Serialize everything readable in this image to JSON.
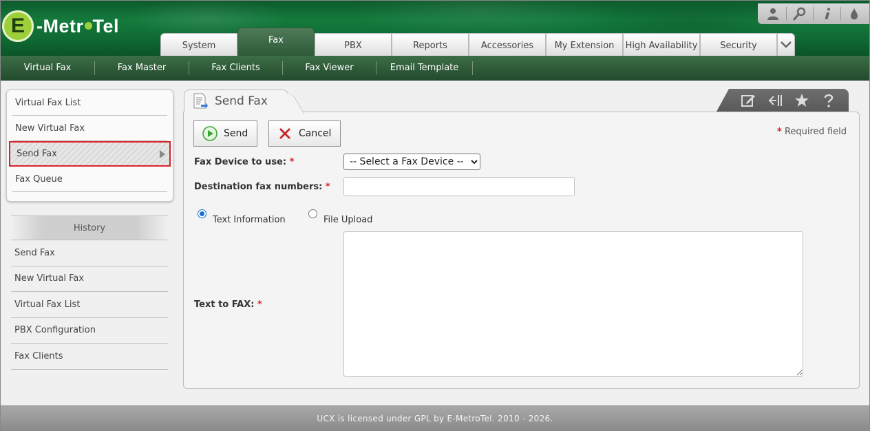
{
  "brand": {
    "logo_letter": "E",
    "logo_word_1": "-Metr",
    "logo_word_2": "Tel"
  },
  "top_tools": [
    "user-icon",
    "search-icon",
    "info-icon",
    "drop-icon"
  ],
  "main_tabs": [
    {
      "label": "System"
    },
    {
      "label": "Fax",
      "active": true
    },
    {
      "label": "PBX"
    },
    {
      "label": "Reports"
    },
    {
      "label": "Accessories"
    },
    {
      "label": "My Extension"
    },
    {
      "label": "High Availability"
    },
    {
      "label": "Security"
    }
  ],
  "sub_nav": [
    {
      "label": "Virtual Fax",
      "active": true
    },
    {
      "label": "Fax Master"
    },
    {
      "label": "Fax Clients"
    },
    {
      "label": "Fax Viewer"
    },
    {
      "label": "Email Template"
    }
  ],
  "left_menu": [
    {
      "label": "Virtual Fax List"
    },
    {
      "label": "New Virtual Fax"
    },
    {
      "label": "Send Fax",
      "active": true
    },
    {
      "label": "Fax Queue"
    }
  ],
  "history": {
    "title": "History",
    "items": [
      {
        "label": "Send Fax"
      },
      {
        "label": "New Virtual Fax"
      },
      {
        "label": "Virtual Fax List"
      },
      {
        "label": "PBX Configuration"
      },
      {
        "label": "Fax Clients"
      }
    ]
  },
  "content": {
    "title": "Send Fax",
    "send_label": "Send",
    "cancel_label": "Cancel",
    "required_note": "Required field",
    "required_star": "*",
    "fax_device_label": "Fax Device to use:",
    "fax_device_selected": "-- Select a Fax Device --",
    "destination_label": "Destination fax numbers:",
    "radio_text_label": "Text Information",
    "radio_file_label": "File Upload",
    "text_to_fax_label": "Text to FAX:",
    "radio_selected": "text"
  },
  "footer": {
    "text": "UCX is licensed under GPL by E-MetroTel. 2010 - 2026."
  },
  "colors": {
    "header_green": "#137a3c",
    "subnav_green": "#2f5a3a",
    "logo_lime": "#9ccf3a",
    "required_red": "#d9232a",
    "radio_blue": "#1a6fd4"
  }
}
